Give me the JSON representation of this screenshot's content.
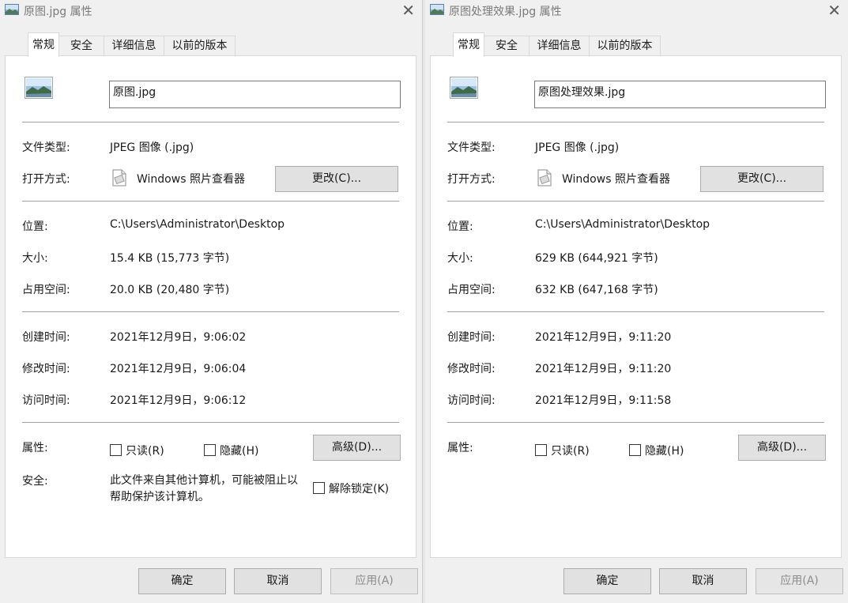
{
  "dialogs": [
    {
      "title": "原图.jpg 属性",
      "tabs": [
        "常规",
        "安全",
        "详细信息",
        "以前的版本"
      ],
      "filename": "原图.jpg",
      "rows": {
        "file_type": {
          "label": "文件类型:",
          "value": "JPEG 图像 (.jpg)"
        },
        "open_with": {
          "label": "打开方式:",
          "value": "Windows 照片查看器"
        },
        "change_button": "更改(C)...",
        "location": {
          "label": "位置:",
          "value": "C:\\Users\\Administrator\\Desktop"
        },
        "size": {
          "label": "大小:",
          "value": "15.4 KB (15,773 字节)"
        },
        "size_on_disk": {
          "label": "占用空间:",
          "value": "20.0 KB (20,480 字节)"
        },
        "created": {
          "label": "创建时间:",
          "value": "2021年12月9日，9:06:02"
        },
        "modified": {
          "label": "修改时间:",
          "value": "2021年12月9日，9:06:04"
        },
        "accessed": {
          "label": "访问时间:",
          "value": "2021年12月9日，9:06:12"
        },
        "attributes_label": "属性:",
        "readonly": "只读(R)",
        "hidden": "隐藏(H)",
        "advanced_button": "高级(D)...",
        "security_label": "安全:",
        "security_text": "此文件来自其他计算机，可能被阻止以帮助保护该计算机。",
        "unblock": "解除锁定(K)"
      },
      "buttons": {
        "ok": "确定",
        "cancel": "取消",
        "apply": "应用(A)"
      }
    },
    {
      "title": "原图处理效果.jpg 属性",
      "tabs": [
        "常规",
        "安全",
        "详细信息",
        "以前的版本"
      ],
      "filename": "原图处理效果.jpg",
      "rows": {
        "file_type": {
          "label": "文件类型:",
          "value": "JPEG 图像 (.jpg)"
        },
        "open_with": {
          "label": "打开方式:",
          "value": "Windows 照片查看器"
        },
        "change_button": "更改(C)...",
        "location": {
          "label": "位置:",
          "value": "C:\\Users\\Administrator\\Desktop"
        },
        "size": {
          "label": "大小:",
          "value": "629 KB (644,921 字节)"
        },
        "size_on_disk": {
          "label": "占用空间:",
          "value": "632 KB (647,168 字节)"
        },
        "created": {
          "label": "创建时间:",
          "value": "2021年12月9日，9:11:20"
        },
        "modified": {
          "label": "修改时间:",
          "value": "2021年12月9日，9:11:20"
        },
        "accessed": {
          "label": "访问时间:",
          "value": "2021年12月9日，9:11:58"
        },
        "attributes_label": "属性:",
        "readonly": "只读(R)",
        "hidden": "隐藏(H)",
        "advanced_button": "高级(D)..."
      },
      "buttons": {
        "ok": "确定",
        "cancel": "取消",
        "apply": "应用(A)"
      }
    }
  ],
  "icons": {
    "title_icon": "image-file-icon",
    "file_icon": "image-thumbnail-icon",
    "app_icon": "photo-viewer-icon",
    "close_icon": "close-icon"
  }
}
